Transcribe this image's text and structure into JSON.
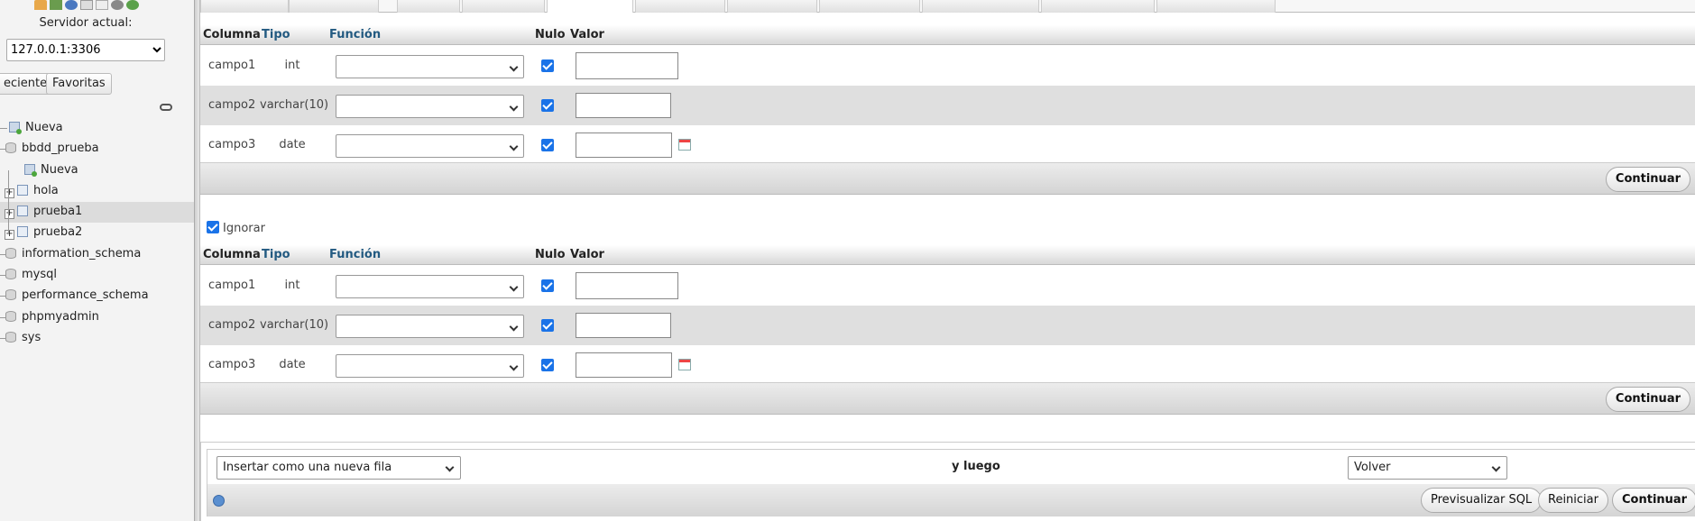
{
  "nav": {
    "server_label": "Servidor actual:",
    "server_value": "127.0.0.1:3306",
    "tab_recent": "eciente",
    "tab_favorites": "Favoritas",
    "tree": {
      "new_root": "Nueva",
      "db_selected": "bbdd_prueba",
      "new_table": "Nueva",
      "tables": [
        "hola",
        "prueba1",
        "prueba2"
      ],
      "other_dbs": [
        "information_schema",
        "mysql",
        "performance_schema",
        "phpmyadmin",
        "sys"
      ]
    }
  },
  "form": {
    "headers": {
      "column": "Columna",
      "type": "Tipo",
      "function": "Función",
      "null": "Nulo",
      "value": "Valor"
    },
    "rows_1": [
      {
        "column": "campo1",
        "type": "int"
      },
      {
        "column": "campo2",
        "type": "varchar(10)"
      },
      {
        "column": "campo3",
        "type": "date"
      }
    ],
    "rows_2": [
      {
        "column": "campo1",
        "type": "int"
      },
      {
        "column": "campo2",
        "type": "varchar(10)"
      },
      {
        "column": "campo3",
        "type": "date"
      }
    ],
    "continue_label": "Continuar",
    "ignore_label": "Ignorar"
  },
  "bottom": {
    "insert_mode": "Insertar como una nueva fila",
    "then_label": "y luego",
    "after_action": "Volver",
    "preview_sql": "Previsualizar SQL",
    "reset": "Reiniciar",
    "continue": "Continuar"
  },
  "colors": {
    "link": "#235a81",
    "checkbox": "#1a73e8",
    "row_alt": "#dfdfdf"
  }
}
